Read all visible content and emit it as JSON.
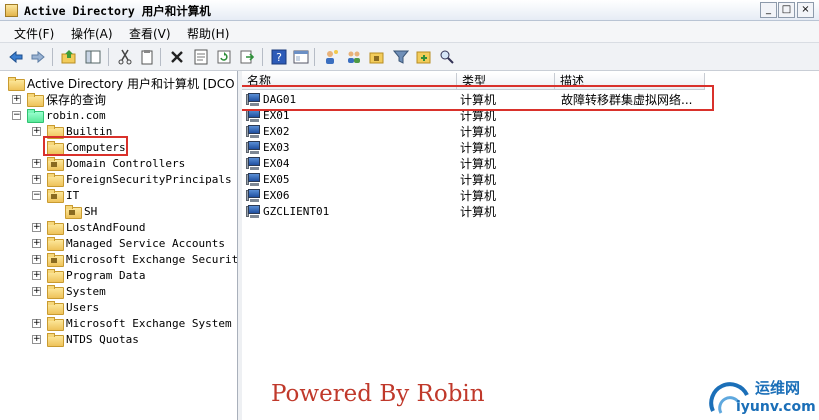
{
  "window": {
    "title": "Active Directory 用户和计算机",
    "buttons": {
      "minimize": "_",
      "maximize": "□",
      "close": "×"
    }
  },
  "menu": [
    {
      "label": "文件(F)"
    },
    {
      "label": "操作(A)"
    },
    {
      "label": "查看(V)"
    },
    {
      "label": "帮助(H)"
    }
  ],
  "toolbar": {
    "icons": [
      "back-icon",
      "forward-icon",
      "up-icon",
      "show-hide-tree-icon",
      "cut-icon",
      "copy-icon",
      "delete-icon",
      "properties-icon",
      "refresh-icon",
      "export-icon",
      "help-icon",
      "console-icon",
      "new-user-icon",
      "new-group-icon",
      "new-ou-icon",
      "filter-icon",
      "add-to-group-icon",
      "find-icon"
    ]
  },
  "tree": {
    "root": "Active Directory 用户和计算机 [DCO",
    "saved_queries": "保存的查询",
    "domain": "robin.com",
    "items": [
      {
        "label": "Builtin",
        "expandable": true
      },
      {
        "label": "Computers",
        "expandable": false,
        "selected": true
      },
      {
        "label": "Domain Controllers",
        "expandable": true
      },
      {
        "label": "ForeignSecurityPrincipals",
        "expandable": true
      },
      {
        "label": "IT",
        "expandable": true,
        "expanded": true
      },
      {
        "label": "SH",
        "expandable": false,
        "child": true
      },
      {
        "label": "LostAndFound",
        "expandable": true
      },
      {
        "label": "Managed Service Accounts",
        "expandable": true
      },
      {
        "label": "Microsoft Exchange Security",
        "expandable": true
      },
      {
        "label": "Program Data",
        "expandable": true
      },
      {
        "label": "System",
        "expandable": true
      },
      {
        "label": "Users",
        "expandable": false
      },
      {
        "label": "Microsoft Exchange System Ob",
        "expandable": true
      },
      {
        "label": "NTDS Quotas",
        "expandable": true
      }
    ]
  },
  "list": {
    "columns": [
      "名称",
      "类型",
      "描述"
    ],
    "rows": [
      {
        "name": "DAG01",
        "type": "计算机",
        "desc": "故障转移群集虚拟网络..."
      },
      {
        "name": "EX01",
        "type": "计算机",
        "desc": ""
      },
      {
        "name": "EX02",
        "type": "计算机",
        "desc": ""
      },
      {
        "name": "EX03",
        "type": "计算机",
        "desc": ""
      },
      {
        "name": "EX04",
        "type": "计算机",
        "desc": ""
      },
      {
        "name": "EX05",
        "type": "计算机",
        "desc": ""
      },
      {
        "name": "EX06",
        "type": "计算机",
        "desc": ""
      },
      {
        "name": "GZCLIENT01",
        "type": "计算机",
        "desc": ""
      }
    ]
  },
  "overlay": {
    "watermark": "Powered By Robin",
    "site_name": "运维网",
    "site_url": "iyunv.com",
    "highlight_color": "#d9312b"
  }
}
